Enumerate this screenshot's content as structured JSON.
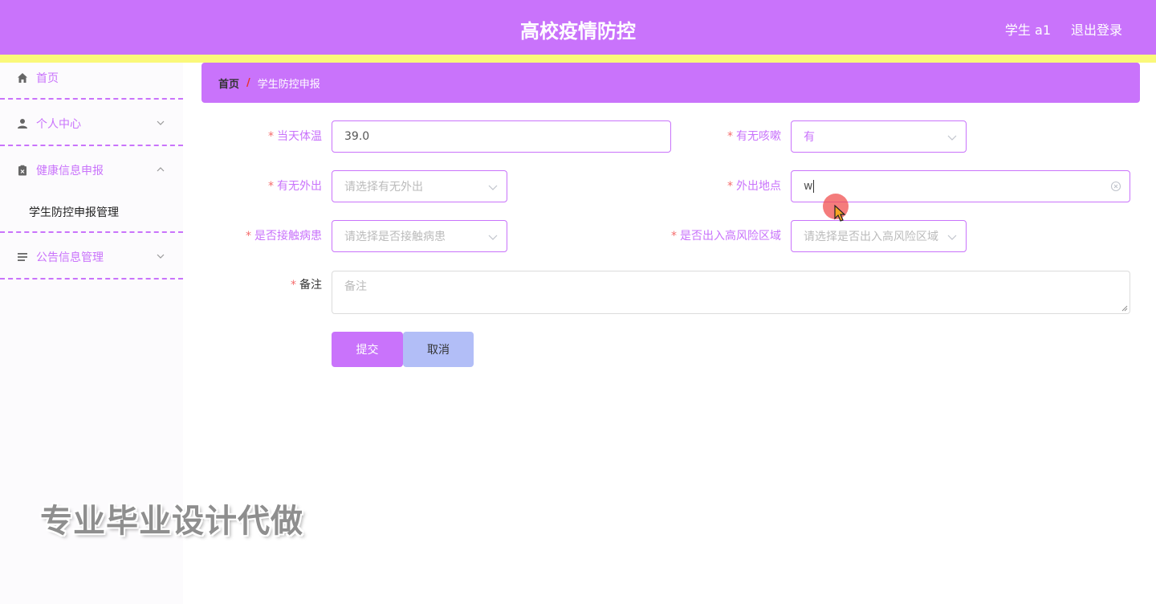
{
  "header": {
    "title": "高校疫情防控",
    "user": "学生 a1",
    "logout": "退出登录"
  },
  "sidebar": {
    "items": [
      {
        "label": "首页",
        "icon": "home-icon"
      },
      {
        "label": "个人中心",
        "icon": "user-icon"
      },
      {
        "label": "健康信息申报",
        "icon": "clipboard-icon"
      },
      {
        "label": "公告信息管理",
        "icon": "list-icon"
      }
    ],
    "submenu": {
      "label": "学生防控申报管理"
    }
  },
  "breadcrumb": {
    "home": "首页",
    "separator": "/",
    "current": "学生防控申报"
  },
  "form": {
    "required_mark": "*",
    "temperature": {
      "label": "当天体温",
      "value": "39.0"
    },
    "cough": {
      "label": "有无咳嗽",
      "value": "有"
    },
    "went_out": {
      "label": "有无外出",
      "placeholder": "请选择有无外出"
    },
    "location": {
      "label": "外出地点",
      "value": "w"
    },
    "contact": {
      "label": "是否接触病患",
      "placeholder": "请选择是否接触病患"
    },
    "high_risk": {
      "label": "是否出入高风险区域",
      "placeholder": "请选择是否出入高风险区域"
    },
    "remark": {
      "label": "备注",
      "placeholder": "备注"
    },
    "submit": "提交",
    "cancel": "取消"
  },
  "watermark": "专业毕业设计代做",
  "colors": {
    "primary": "#c973fb",
    "accent_yellow": "#faf87a",
    "cancel_button": "#b2bef7",
    "required": "#f56c6c"
  }
}
